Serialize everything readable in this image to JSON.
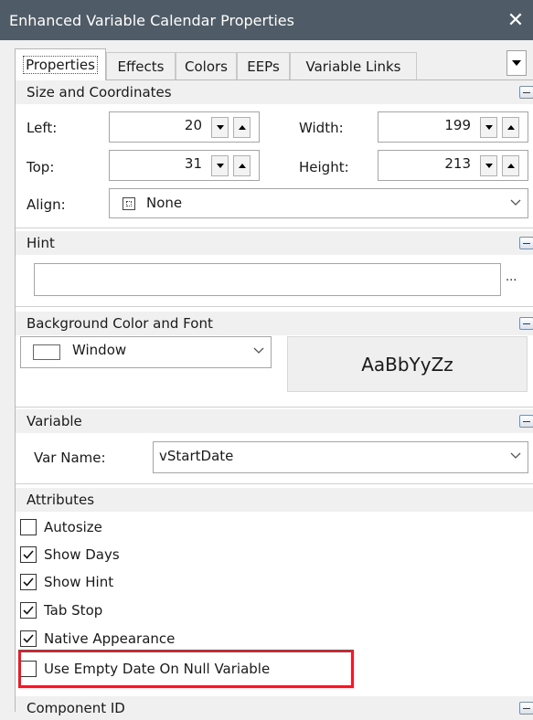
{
  "window": {
    "title": "Enhanced Variable Calendar Properties",
    "close_glyph": "✕"
  },
  "tabs": [
    "Properties",
    "Effects",
    "Colors",
    "EEPs",
    "Variable Links"
  ],
  "sections": {
    "size_coords": {
      "title": "Size and Coordinates",
      "left_label": "Left:",
      "left_value": "20",
      "top_label": "Top:",
      "top_value": "31",
      "width_label": "Width:",
      "width_value": "199",
      "height_label": "Height:",
      "height_value": "213",
      "align_label": "Align:",
      "align_value": "None"
    },
    "hint": {
      "title": "Hint",
      "value": "",
      "ellipsis": "..."
    },
    "background": {
      "title": "Background Color and Font",
      "color_value": "Window",
      "font_preview": "AaBbYyZz"
    },
    "variable": {
      "title": "Variable",
      "var_name_label": "Var Name:",
      "var_name_value": "vStartDate"
    },
    "attributes": {
      "title": "Attributes",
      "items": [
        {
          "label": "Autosize",
          "checked": false
        },
        {
          "label": "Show Days",
          "checked": true
        },
        {
          "label": "Show Hint",
          "checked": true
        },
        {
          "label": "Tab Stop",
          "checked": true
        },
        {
          "label": "Native Appearance",
          "checked": true
        },
        {
          "label": "Use Empty Date On Null Variable",
          "checked": false
        }
      ]
    },
    "component_id": {
      "title": "Component ID"
    }
  },
  "colors": {
    "titlebar": "#4f5b66",
    "highlight": "#d9232e"
  }
}
